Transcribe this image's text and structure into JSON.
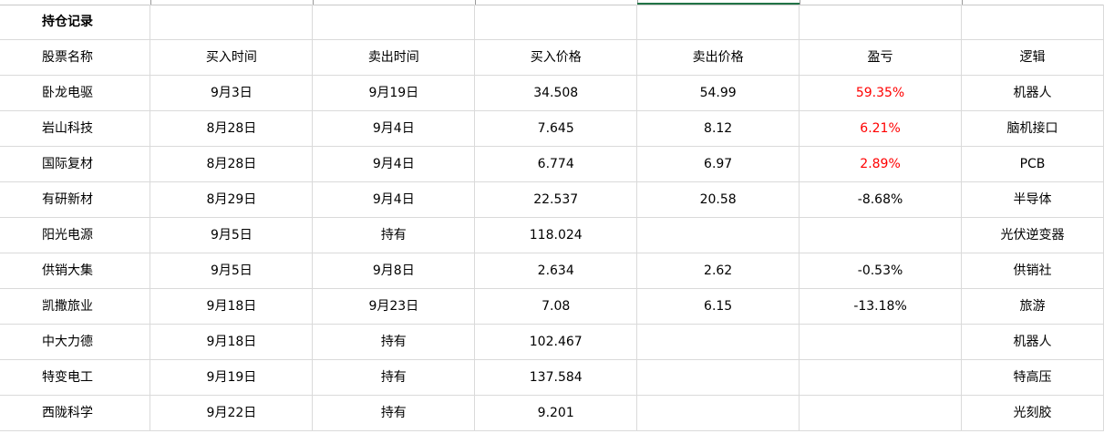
{
  "sheet": {
    "title": "持仓记录",
    "headers": [
      "股票名称",
      "买入时间",
      "卖出时间",
      "买入价格",
      "卖出价格",
      "盈亏",
      "逻辑"
    ],
    "rows": [
      {
        "name": "卧龙电驱",
        "buy_date": "9月3日",
        "sell_date": "9月19日",
        "buy_price": "34.508",
        "sell_price": "54.99",
        "pnl": "59.35%",
        "pnl_positive": true,
        "logic": "机器人"
      },
      {
        "name": "岩山科技",
        "buy_date": "8月28日",
        "sell_date": "9月4日",
        "buy_price": "7.645",
        "sell_price": "8.12",
        "pnl": "6.21%",
        "pnl_positive": true,
        "logic": "脑机接口"
      },
      {
        "name": "国际复材",
        "buy_date": "8月28日",
        "sell_date": "9月4日",
        "buy_price": "6.774",
        "sell_price": "6.97",
        "pnl": "2.89%",
        "pnl_positive": true,
        "logic": "PCB"
      },
      {
        "name": "有研新材",
        "buy_date": "8月29日",
        "sell_date": "9月4日",
        "buy_price": "22.537",
        "sell_price": "20.58",
        "pnl": "-8.68%",
        "pnl_positive": false,
        "logic": "半导体"
      },
      {
        "name": "阳光电源",
        "buy_date": "9月5日",
        "sell_date": "持有",
        "buy_price": "118.024",
        "sell_price": "",
        "pnl": "",
        "pnl_positive": false,
        "logic": "光伏逆变器"
      },
      {
        "name": "供销大集",
        "buy_date": "9月5日",
        "sell_date": "9月8日",
        "buy_price": "2.634",
        "sell_price": "2.62",
        "pnl": "-0.53%",
        "pnl_positive": false,
        "logic": "供销社"
      },
      {
        "name": "凯撒旅业",
        "buy_date": "9月18日",
        "sell_date": "9月23日",
        "buy_price": "7.08",
        "sell_price": "6.15",
        "pnl": "-13.18%",
        "pnl_positive": false,
        "logic": "旅游"
      },
      {
        "name": "中大力德",
        "buy_date": "9月18日",
        "sell_date": "持有",
        "buy_price": "102.467",
        "sell_price": "",
        "pnl": "",
        "pnl_positive": false,
        "logic": "机器人"
      },
      {
        "name": "特变电工",
        "buy_date": "9月19日",
        "sell_date": "持有",
        "buy_price": "137.584",
        "sell_price": "",
        "pnl": "",
        "pnl_positive": false,
        "logic": "特高压"
      },
      {
        "name": "西陇科学",
        "buy_date": "9月22日",
        "sell_date": "持有",
        "buy_price": "9.201",
        "sell_price": "",
        "pnl": "",
        "pnl_positive": false,
        "logic": "光刻胶"
      }
    ]
  },
  "colors": {
    "gain": "#ff0000",
    "grid_line": "#dadada",
    "active_column_accent": "#217346"
  }
}
